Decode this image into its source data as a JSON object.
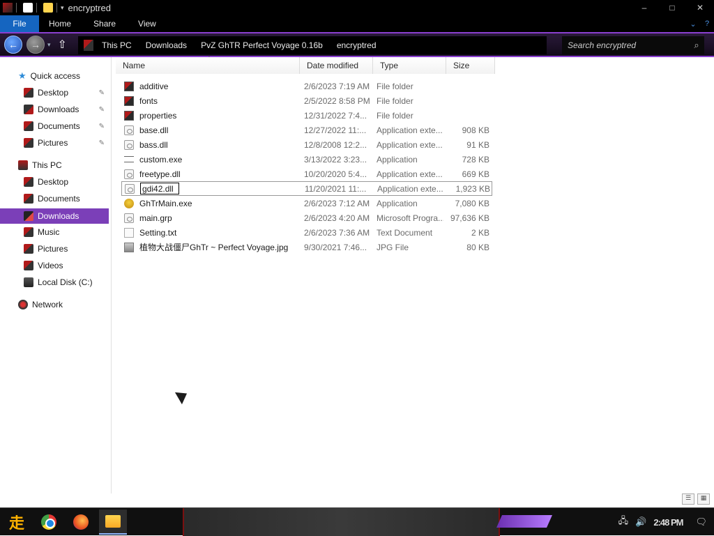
{
  "window": {
    "title": "encryptred",
    "minimize_label": "–",
    "maximize_label": "□",
    "close_label": "✕"
  },
  "ribbon": {
    "tabs": [
      "File",
      "Home",
      "Share",
      "View"
    ],
    "collapse_glyph": "⌄",
    "help_glyph": "?"
  },
  "address": {
    "crumbs": [
      "This PC",
      "Downloads",
      "PvZ GhTR Perfect Voyage 0.16b",
      "encryptred"
    ],
    "up_glyph": "⇧",
    "back_glyph": "←",
    "forward_glyph": "→",
    "dropdown_glyph": "▾"
  },
  "search": {
    "placeholder": "Search encryptred",
    "icon_glyph": "⌕"
  },
  "nav_pane": {
    "items": [
      {
        "label": "Quick access",
        "icon": "star-icon",
        "pinned": false,
        "level": 0
      },
      {
        "label": "Desktop",
        "icon": "desktop-icon",
        "pinned": true,
        "level": 1
      },
      {
        "label": "Downloads",
        "icon": "downloads-icon",
        "pinned": true,
        "level": 1
      },
      {
        "label": "Documents",
        "icon": "documents-icon",
        "pinned": true,
        "level": 1
      },
      {
        "label": "Pictures",
        "icon": "pictures-icon",
        "pinned": true,
        "level": 1
      },
      {
        "label": "This PC",
        "icon": "computer-icon",
        "pinned": false,
        "level": 0
      },
      {
        "label": "Desktop",
        "icon": "desktop-icon",
        "pinned": false,
        "level": 1
      },
      {
        "label": "Documents",
        "icon": "documents-icon",
        "pinned": false,
        "level": 1
      },
      {
        "label": "Downloads",
        "icon": "downloads-icon",
        "pinned": false,
        "level": 1,
        "selected": true
      },
      {
        "label": "Music",
        "icon": "music-icon",
        "pinned": false,
        "level": 1
      },
      {
        "label": "Pictures",
        "icon": "pictures-icon",
        "pinned": false,
        "level": 1
      },
      {
        "label": "Videos",
        "icon": "videos-icon",
        "pinned": false,
        "level": 1
      },
      {
        "label": "Local Disk (C:)",
        "icon": "disk-icon",
        "pinned": false,
        "level": 1
      },
      {
        "label": "Network",
        "icon": "network-icon",
        "pinned": false,
        "level": 0
      }
    ],
    "pin_glyph": "📌"
  },
  "columns": {
    "name": "Name",
    "date": "Date modified",
    "type": "Type",
    "size": "Size"
  },
  "files": [
    {
      "name": "additive",
      "date": "2/6/2023 7:19 AM",
      "type": "File folder",
      "size": "",
      "icon": "folder-icon"
    },
    {
      "name": "fonts",
      "date": "2/5/2022 8:58 PM",
      "type": "File folder",
      "size": "",
      "icon": "folder-icon"
    },
    {
      "name": "properties",
      "date": "12/31/2022 7:4...",
      "type": "File folder",
      "size": "",
      "icon": "folder-icon"
    },
    {
      "name": "base.dll",
      "date": "12/27/2022 11:...",
      "type": "Application exte...",
      "size": "908 KB",
      "icon": "dll-icon"
    },
    {
      "name": "bass.dll",
      "date": "12/8/2008 12:2...",
      "type": "Application exte...",
      "size": "91 KB",
      "icon": "dll-icon"
    },
    {
      "name": "custom.exe",
      "date": "3/13/2022 3:23...",
      "type": "Application",
      "size": "728 KB",
      "icon": "exe-icon"
    },
    {
      "name": "freetype.dll",
      "date": "10/20/2020 5:4...",
      "type": "Application exte...",
      "size": "669 KB",
      "icon": "dll-icon"
    },
    {
      "name": "gdi42.dll",
      "date": "11/20/2021 11:...",
      "type": "Application exte...",
      "size": "1,923 KB",
      "icon": "dll-icon",
      "editing": true
    },
    {
      "name": "GhTrMain.exe",
      "date": "2/6/2023 7:12 AM",
      "type": "Application",
      "size": "7,080 KB",
      "icon": "game-icon"
    },
    {
      "name": "main.grp",
      "date": "2/6/2023 4:20 AM",
      "type": "Microsoft Progra...",
      "size": "97,636 KB",
      "icon": "dll-icon"
    },
    {
      "name": "Setting.txt",
      "date": "2/6/2023 7:36 AM",
      "type": "Text Document",
      "size": "2 KB",
      "icon": "text-file-icon"
    },
    {
      "name": "植物大战僵尸GhTr ~ Perfect Voyage.jpg",
      "date": "9/30/2021 7:46...",
      "type": "JPG File",
      "size": "80 KB",
      "icon": "image-file-icon"
    }
  ],
  "taskbar": {
    "start_glyph": "走",
    "clock": "2:48 PM",
    "network_glyph": "🖧",
    "volume_glyph": "🔊",
    "notification_glyph": "🗨"
  },
  "view_buttons": {
    "details_glyph": "☰",
    "tiles_glyph": "▦"
  }
}
